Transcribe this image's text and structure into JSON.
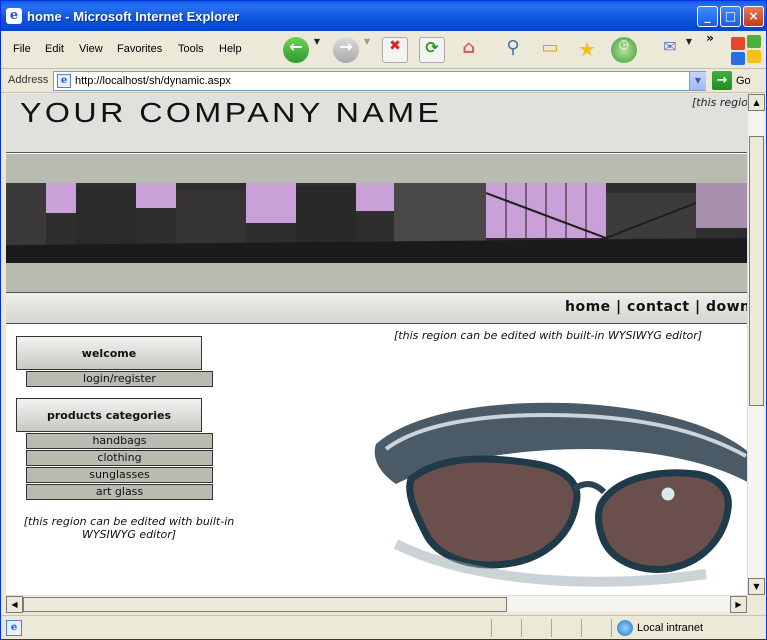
{
  "window": {
    "title": "home - Microsoft Internet Explorer"
  },
  "menu": [
    "File",
    "Edit",
    "View",
    "Favorites",
    "Tools",
    "Help"
  ],
  "toolbar": {
    "more_glyph": "»"
  },
  "address": {
    "label": "Address",
    "url": "http://localhost/sh/dynamic.aspx",
    "go_label": "Go"
  },
  "page": {
    "company_name": "YOUR COMPANY NAME",
    "header_note": "[this region can be edited with built-in WYSIWYG editor]",
    "nav": {
      "home": "home",
      "sep1": "|",
      "contact": "contact",
      "sep2": "|",
      "download": "download"
    },
    "sidebar": {
      "welcome": "welcome",
      "login": "login/register",
      "products_heading": "products categories",
      "categories": [
        "handbags",
        "clothing",
        "sunglasses",
        "art glass"
      ],
      "note": "[this region can be edited with built-in WYSIWYG editor]"
    },
    "main_note": "[this region can be edited with built-in WYSIWYG editor]"
  },
  "status": {
    "zone": "Local intranet"
  },
  "colors": {
    "title_bar": "#0a5fe8",
    "band": "#b8bbb0",
    "banner_sky": "#c9a0d8"
  }
}
